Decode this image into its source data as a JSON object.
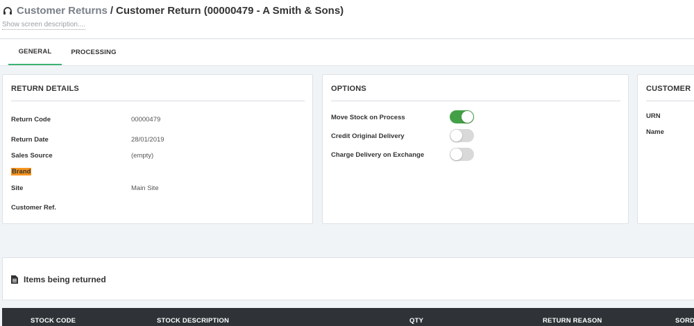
{
  "header": {
    "breadcrumb_parent": "Customer Returns",
    "breadcrumb_separator": "/",
    "breadcrumb_current": "Customer Return (00000479 - A Smith & Sons)",
    "description_link": "Show screen description...."
  },
  "tabs": [
    {
      "label": "GENERAL",
      "active": true
    },
    {
      "label": "PROCESSING",
      "active": false
    }
  ],
  "return_details": {
    "title": "RETURN DETAILS",
    "fields": [
      {
        "label": "Return Code",
        "value": "00000479"
      },
      {
        "label": "Return Date",
        "value": "28/01/2019"
      },
      {
        "label": "Sales Source",
        "value": "(empty)"
      },
      {
        "label": "Brand",
        "value": ""
      },
      {
        "label": "Site",
        "value": "Main Site"
      },
      {
        "label": "Customer Ref.",
        "value": ""
      }
    ]
  },
  "options": {
    "title": "OPTIONS",
    "items": [
      {
        "label": "Move Stock on Process",
        "enabled": true
      },
      {
        "label": "Credit Original Delivery",
        "enabled": false
      },
      {
        "label": "Charge Delivery on Exchange",
        "enabled": false
      }
    ]
  },
  "customer": {
    "title": "CUSTOMER",
    "fields": [
      {
        "label": "URN"
      },
      {
        "label": "Name"
      }
    ]
  },
  "items_section": {
    "title": "Items being returned"
  },
  "table": {
    "columns": [
      "STOCK CODE",
      "STOCK DESCRIPTION",
      "QTY",
      "RETURN REASON",
      "SORD"
    ]
  },
  "colors": {
    "accent_green": "#3cb371",
    "toggle_on": "#43a047",
    "highlight_orange": "#f7941d",
    "table_header": "#2f3338"
  }
}
